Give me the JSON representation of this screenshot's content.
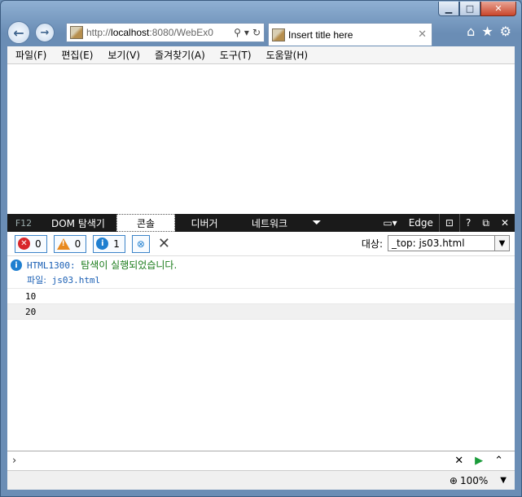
{
  "browser": {
    "address_prefix": "http://",
    "address_host": "localhost",
    "address_rest": ":8080/WebEx0",
    "tab_title": "Insert title here"
  },
  "menu": [
    "파일(F)",
    "편집(E)",
    "보기(V)",
    "즐겨찾기(A)",
    "도구(T)",
    "도움말(H)"
  ],
  "devtools": {
    "tabs": {
      "f12": "F12",
      "dom": "DOM 탐색기",
      "console": "콘솔",
      "debugger": "디버거",
      "network": "네트워크"
    },
    "edge_label": "Edge",
    "counts": {
      "errors": "0",
      "warnings": "0",
      "info": "1"
    },
    "target_label": "대상:",
    "target_value": "_top: js03.html",
    "messages": {
      "code": "HTML1300:",
      "text": "탐색이 실행되었습니다.",
      "file_label": "파일:",
      "file_name": "js03.html"
    },
    "logs": [
      "10",
      "20"
    ]
  },
  "status": {
    "zoom": "100%"
  },
  "colors": {
    "accent": "#1f7fd0",
    "error": "#d8262b",
    "warning": "#e8891e",
    "run": "#1a9b3a"
  }
}
